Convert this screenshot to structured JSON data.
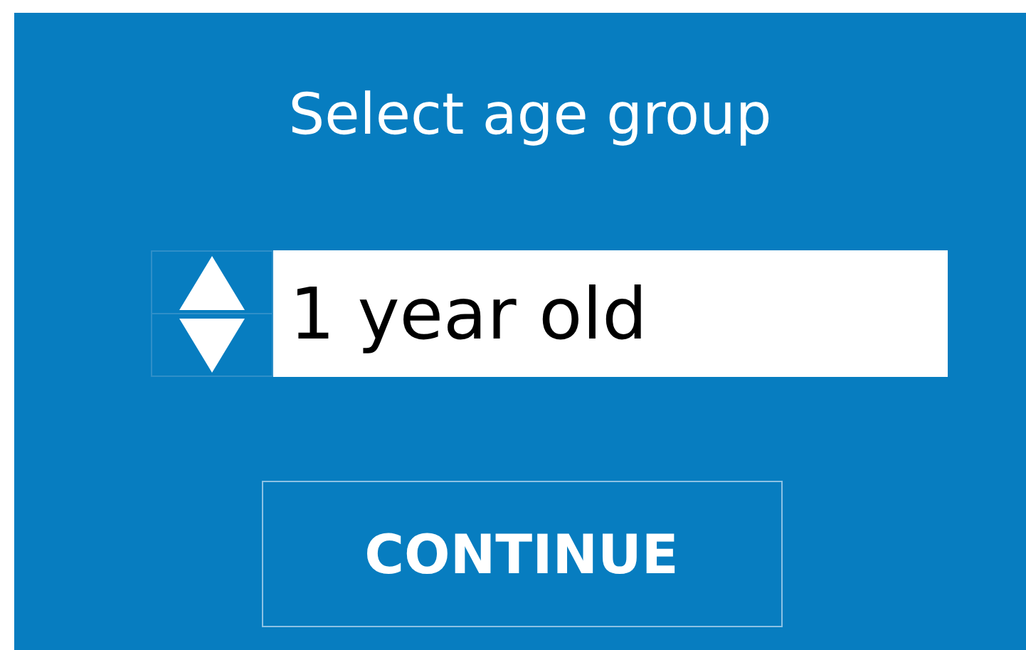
{
  "title": "Select age group",
  "age_field": {
    "value": "1 year old"
  },
  "continue_button": {
    "label": "CONTINUE"
  }
}
